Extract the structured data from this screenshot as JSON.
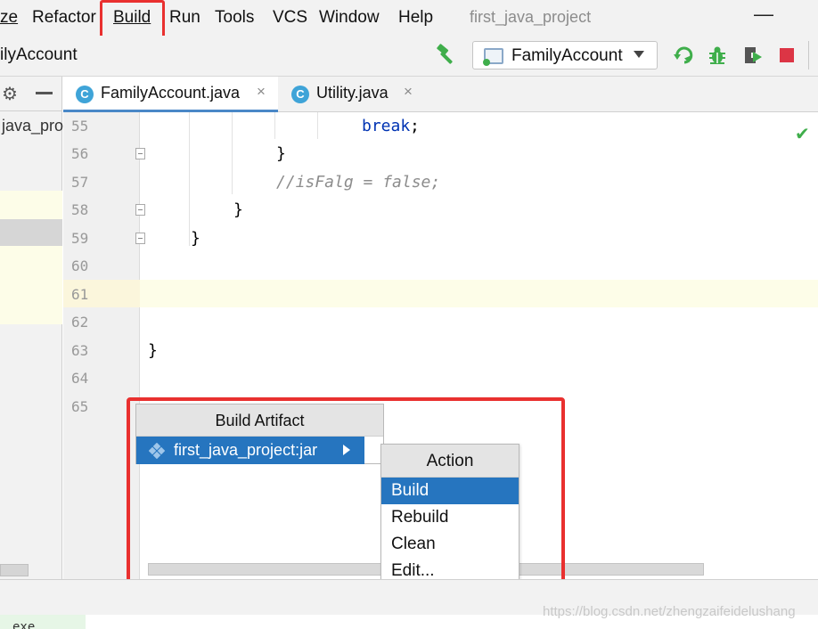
{
  "menubar": {
    "items": [
      {
        "label": "ze"
      },
      {
        "label": "Refactor"
      },
      {
        "label": "Build"
      },
      {
        "label": "Run"
      },
      {
        "label": "Tools"
      },
      {
        "label": "VCS"
      },
      {
        "label": "Window"
      },
      {
        "label": "Help"
      }
    ],
    "project_title": "first_java_project",
    "minimize_symbol": "—"
  },
  "navbar": {
    "breadcrumb": "ilyAccount",
    "run_config": "FamilyAccount",
    "icons": [
      "hammer-icon",
      "rerun-icon",
      "debug-icon",
      "coverage-icon",
      "stop-icon"
    ]
  },
  "project_panel": {
    "gear_symbol": "⚙",
    "tree_item": "java_pro"
  },
  "tabs": [
    {
      "label": "FamilyAccount.java",
      "icon_letter": "C",
      "close": "×",
      "active": true
    },
    {
      "label": "Utility.java",
      "icon_letter": "C",
      "close": "×",
      "active": false
    }
  ],
  "editor": {
    "line_numbers": [
      "55",
      "56",
      "57",
      "58",
      "59",
      "60",
      "61",
      "62",
      "63",
      "64",
      "65"
    ],
    "lines": [
      {
        "keyword": "break",
        "rest": ";"
      },
      {
        "text": "}"
      },
      {
        "comment": "//isFalg = false;"
      },
      {
        "text": "}"
      },
      {
        "text": "}"
      },
      {
        "text": ""
      },
      {
        "text": ""
      },
      {
        "text": ""
      },
      {
        "text": "}"
      },
      {
        "text": ""
      },
      {
        "text": ""
      }
    ],
    "check_symbol": "✔"
  },
  "build_artifact_popup": {
    "title": "Build Artifact",
    "item": "first_java_project:jar"
  },
  "action_popup": {
    "title": "Action",
    "items": [
      "Build",
      "Rebuild",
      "Clean",
      "Edit..."
    ],
    "selected": "Build"
  },
  "bottom": {
    "text": "exe",
    "watermark": "https://blog.csdn.net/zhengzaifeidelushang"
  },
  "colors": {
    "highlight": "#e9302f",
    "selection": "#2675bf",
    "keyword": "#0033b3"
  }
}
